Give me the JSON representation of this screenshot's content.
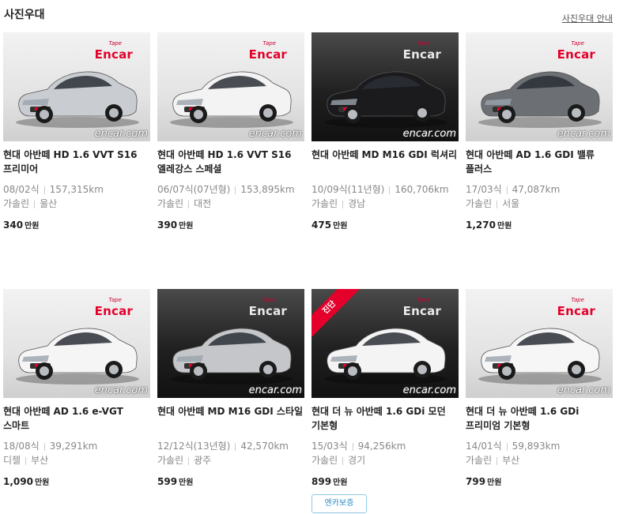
{
  "header": {
    "title": "사진우대",
    "guide_link": "사진우대 안내"
  },
  "logo": {
    "small": "Tape",
    "big": "Encar"
  },
  "watermark": "encar.com",
  "price_unit": "만원",
  "cards": [
    {
      "name": "현대 아반떼 HD 1.6 VVT S16 프리미어",
      "year": "08/02식",
      "mileage": "157,315km",
      "fuel": "가솔린",
      "region": "울산",
      "price": "340",
      "bg": "light",
      "car_color": "#c9ccd1"
    },
    {
      "name": "현대 아반떼 HD 1.6 VVT S16 엘레강스 스페셜",
      "year": "06/07식(07년형)",
      "mileage": "153,895km",
      "fuel": "가솔린",
      "region": "대전",
      "price": "390",
      "bg": "light",
      "car_color": "#f3f3f3"
    },
    {
      "name": "현대 아반떼 MD M16 GDI 럭셔리",
      "year": "10/09식(11년형)",
      "mileage": "160,706km",
      "fuel": "가솔린",
      "region": "경남",
      "price": "475",
      "bg": "dark",
      "car_color": "#1b1b1d"
    },
    {
      "name": "현대 아반떼 AD 1.6 GDI 밸류 플러스",
      "year": "17/03식",
      "mileage": "47,087km",
      "fuel": "가솔린",
      "region": "서울",
      "price": "1,270",
      "bg": "light",
      "car_color": "#6c6f74"
    },
    {
      "name": "현대 아반떼 AD 1.6 e-VGT 스마트",
      "year": "18/08식",
      "mileage": "39,291km",
      "fuel": "디젤",
      "region": "부산",
      "price": "1,090",
      "bg": "light",
      "car_color": "#f5f5f5"
    },
    {
      "name": "현대 아반떼 MD M16 GDI 스타일",
      "year": "12/12식(13년형)",
      "mileage": "42,570km",
      "fuel": "가솔린",
      "region": "광주",
      "price": "599",
      "bg": "dark",
      "car_color": "#c4c6c9"
    },
    {
      "name": "현대 더 뉴 아반떼 1.6 GDi 모던 기본형",
      "year": "15/03식",
      "mileage": "94,256km",
      "fuel": "가솔린",
      "region": "경기",
      "price": "899",
      "bg": "dark",
      "car_color": "#f4f4f4",
      "badge": "진단"
    },
    {
      "name": "현대 더 뉴 아반떼 1.6 GDi 프리미엄 기본형",
      "year": "14/01식",
      "mileage": "59,893km",
      "fuel": "가솔린",
      "region": "부산",
      "price": "799",
      "bg": "light",
      "car_color": "#f6f6f6"
    }
  ],
  "guarantee_button": "엔카보증"
}
